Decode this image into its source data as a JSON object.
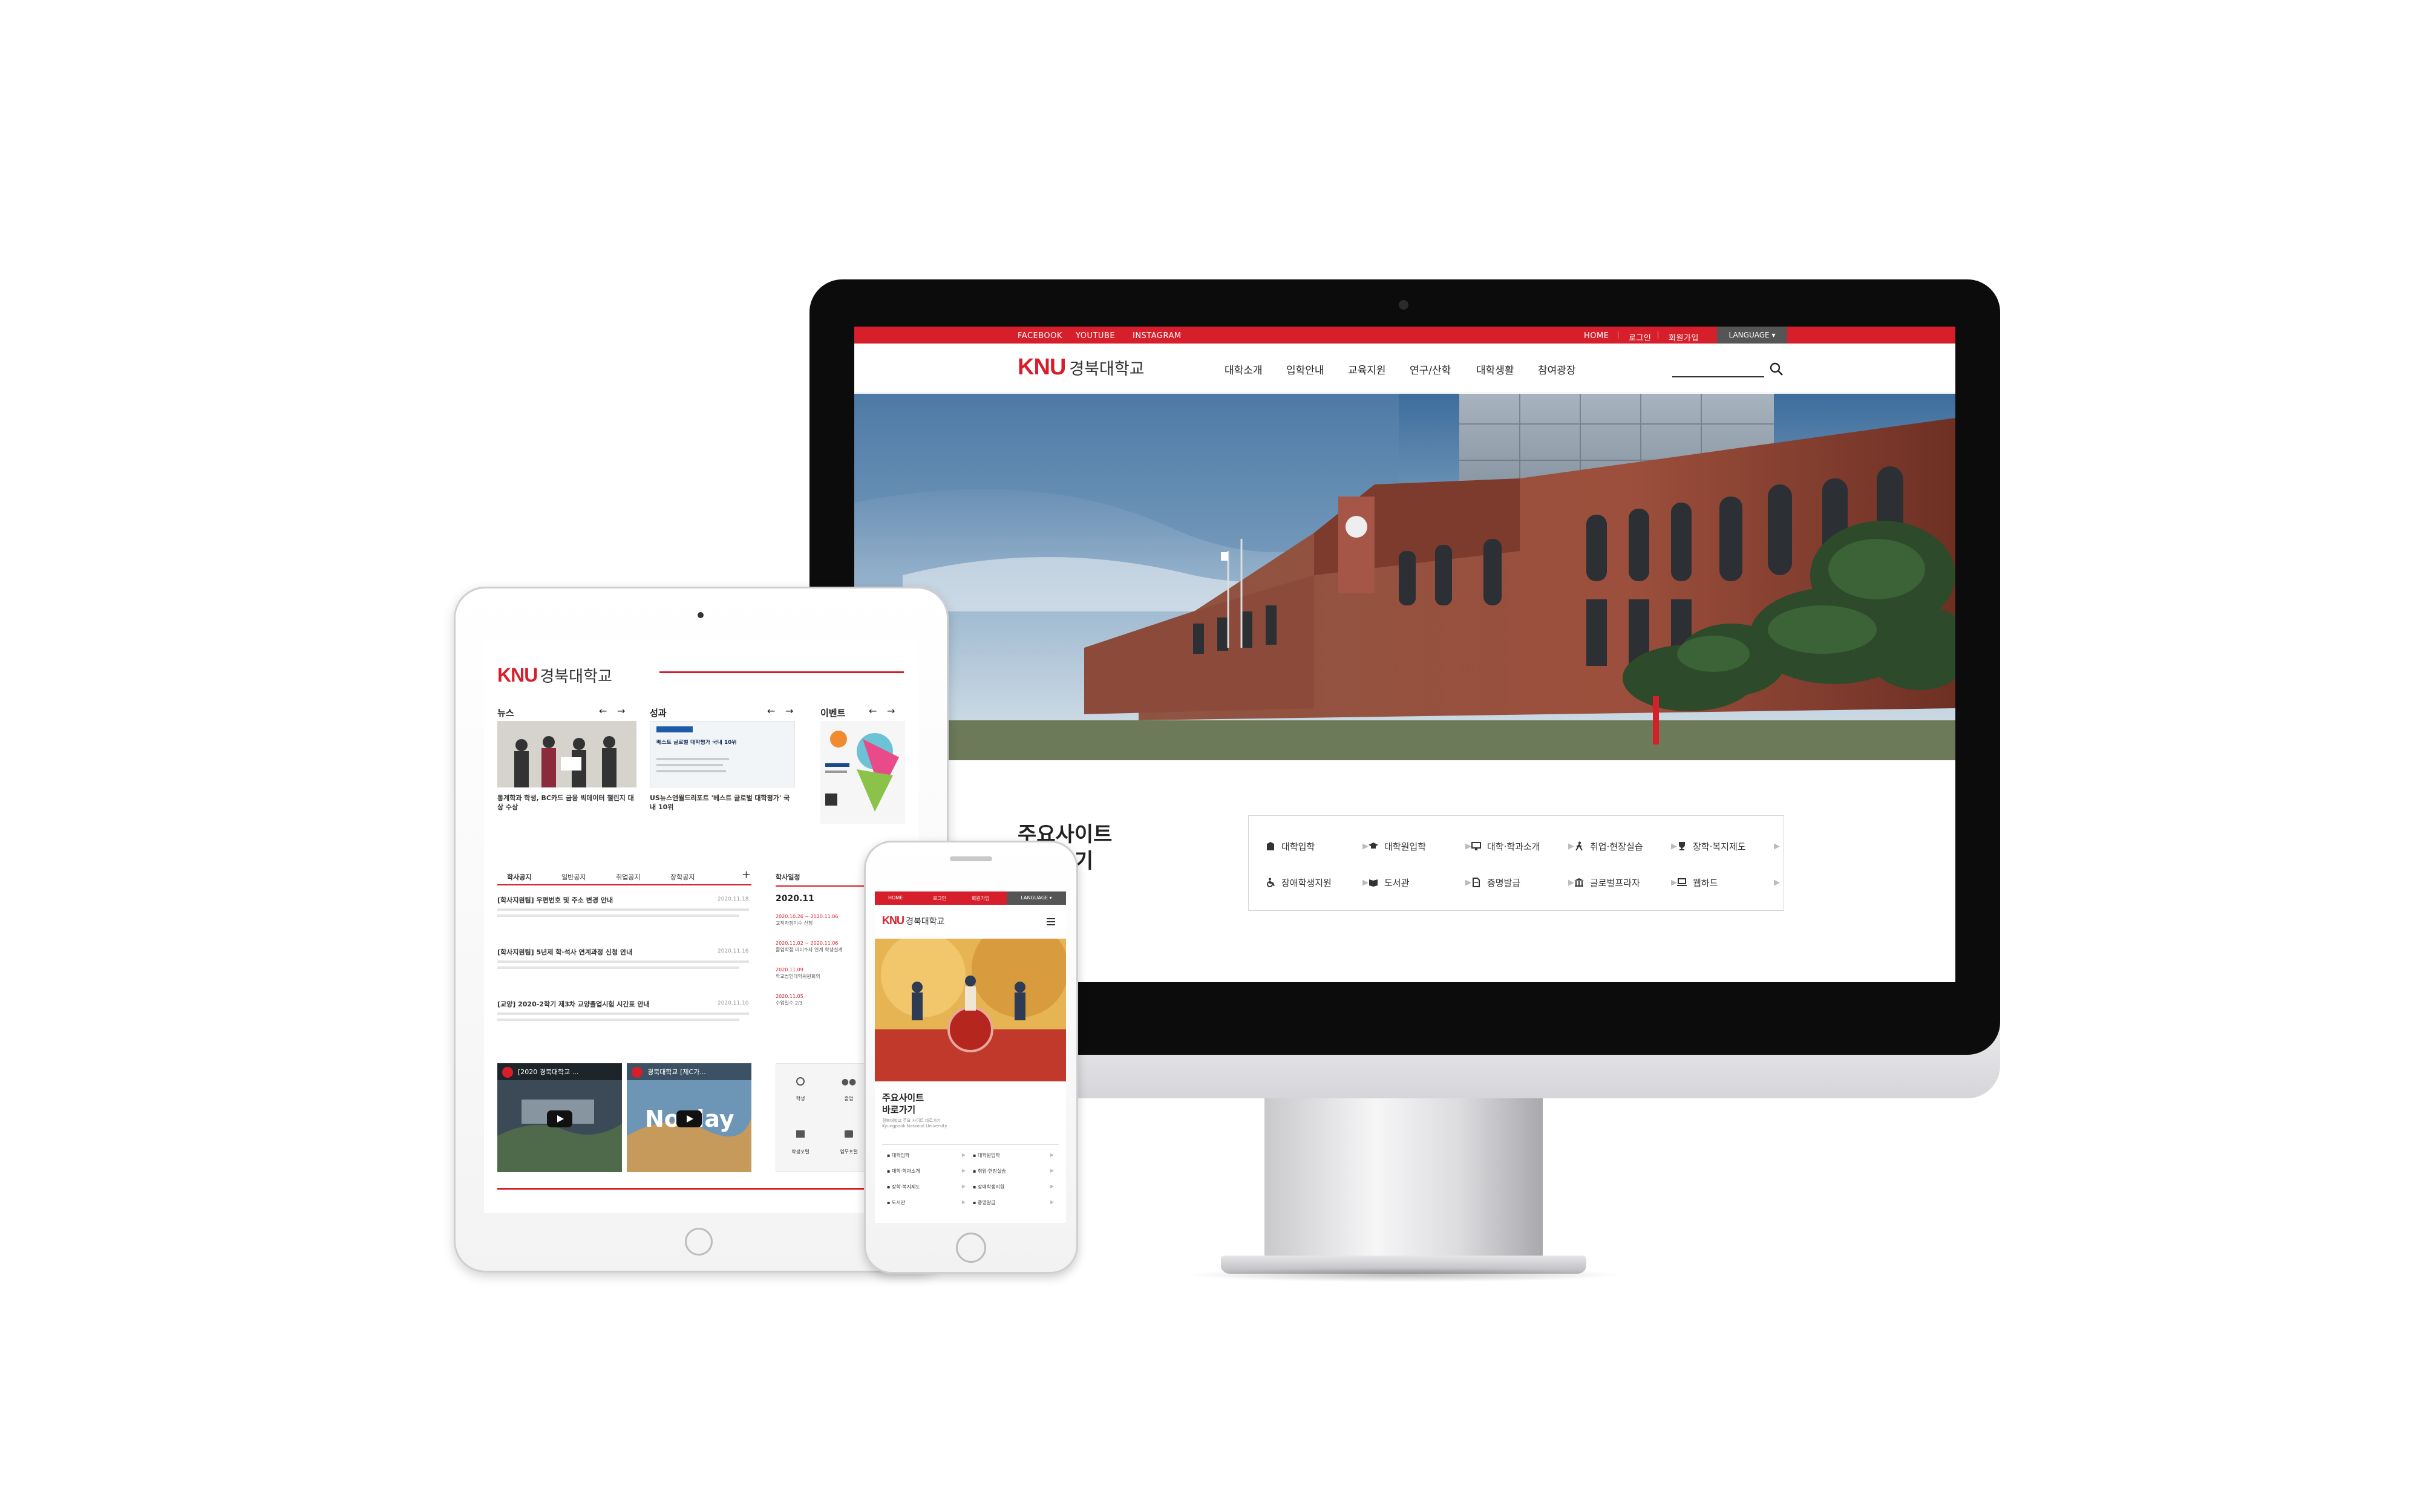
{
  "desktop": {
    "topbar": {
      "social": [
        "FACEBOOK",
        "YOUTUBE",
        "INSTAGRAM"
      ],
      "home": "HOME",
      "login": "로그인",
      "join": "회원가입",
      "language": "LANGUAGE ▾"
    },
    "logo": {
      "mark": "KNU",
      "name": "경북대학교"
    },
    "nav": [
      "대학소개",
      "입학안내",
      "교육지원",
      "연구/산학",
      "대학생활",
      "참여광장"
    ],
    "quick": {
      "title_line1": "주요사이트",
      "title_line2": "바로가기",
      "items": [
        {
          "label": "대학입학",
          "icon": "building-icon"
        },
        {
          "label": "대학원입학",
          "icon": "graduation-cap-icon"
        },
        {
          "label": "대학·학과소개",
          "icon": "monitor-icon"
        },
        {
          "label": "취업·현장실습",
          "icon": "person-walking-icon"
        },
        {
          "label": "장학·복지제도",
          "icon": "trophy-icon"
        },
        {
          "label": "장애학생지원",
          "icon": "wheelchair-icon"
        },
        {
          "label": "도서관",
          "icon": "book-icon"
        },
        {
          "label": "증명발급",
          "icon": "document-icon"
        },
        {
          "label": "글로벌프라자",
          "icon": "institution-icon"
        },
        {
          "label": "웹하드",
          "icon": "laptop-icon"
        }
      ]
    },
    "colors": {
      "accent": "#d71f2b",
      "dark": "#222222"
    }
  },
  "tablet": {
    "logo": {
      "mark": "KNU",
      "name": "경북대학교"
    },
    "sections": {
      "news": {
        "title": "뉴스",
        "headline": "통계학과 학생, BC카드 금융 빅데이터 챌린지 대상 수상"
      },
      "achievement": {
        "title": "성과",
        "headline": "US뉴스앤월드리포트 '베스트 글로벌 대학평가' 국내 10위",
        "poster": "베스트 글로벌 대학평가 국내 10위"
      },
      "event": {
        "title": "이벤트"
      }
    },
    "notice_tabs": [
      "학사공지",
      "일반공지",
      "취업공지",
      "장학공지"
    ],
    "notices": [
      {
        "title": "[학사지원팀] 우편번호 및 주소 변경 안내",
        "date": "2020.11.18"
      },
      {
        "title": "[학사지원팀] 5년제 학·석사 연계과정 신청 안내",
        "date": "2020.11.16"
      },
      {
        "title": "[교양] 2020-2학기 제3차 교양졸업시험 시간표 안내",
        "date": "2020.11.10"
      }
    ],
    "schedule": {
      "title": "학사일정",
      "month": "2020.11",
      "entries": [
        {
          "range": "2020.10.26 ~ 2020.11.06",
          "text": "교직과정이수 신청"
        },
        {
          "range": "2020.11.02 ~ 2020.11.06",
          "text": "졸업학점 미이수자 연계 학생설계"
        },
        {
          "range": "2020.11.09",
          "text": "학교법인대학위원회의"
        },
        {
          "range": "2020.11.05",
          "text": "수업일수 2/3"
        }
      ]
    },
    "videos": [
      {
        "title": "[2020 경북대학교 ..."
      },
      {
        "title": "경북대학교 [제C가..."
      }
    ],
    "video_overlay": "No day",
    "quicklinks": [
      "학생",
      "졸업",
      "학생포털",
      "업무포털"
    ]
  },
  "phone": {
    "topbar": [
      "HOME",
      "로그인",
      "회원가입",
      "LANGUAGE ▾"
    ],
    "logo": {
      "mark": "KNU",
      "name": "경북대학교"
    },
    "quick_title_1": "주요사이트",
    "quick_title_2": "바로가기",
    "quick_sub_1": "경북대학교 주요 사이트 바로가기",
    "quick_sub_2": "Kyungpook National University",
    "items": [
      "대학입학",
      "대학원입학",
      "대학·학과소개",
      "취업·현장실습",
      "장학·복지제도",
      "장애학생지원",
      "도서관",
      "증명발급"
    ]
  }
}
